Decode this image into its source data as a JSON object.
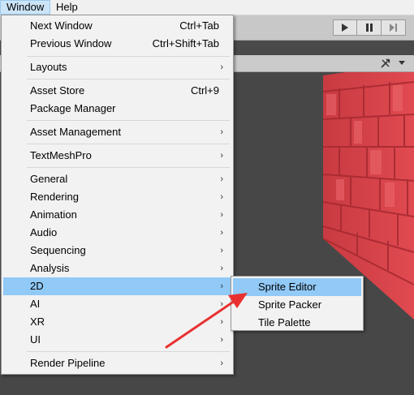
{
  "menubar": {
    "items": [
      "Window",
      "Help"
    ]
  },
  "window_menu": {
    "groups": [
      [
        {
          "label": "Next Window",
          "shortcut": "Ctrl+Tab"
        },
        {
          "label": "Previous Window",
          "shortcut": "Ctrl+Shift+Tab"
        }
      ],
      [
        {
          "label": "Layouts",
          "submenu": true
        }
      ],
      [
        {
          "label": "Asset Store",
          "shortcut": "Ctrl+9"
        },
        {
          "label": "Package Manager"
        }
      ],
      [
        {
          "label": "Asset Management",
          "submenu": true
        }
      ],
      [
        {
          "label": "TextMeshPro",
          "submenu": true
        }
      ],
      [
        {
          "label": "General",
          "submenu": true
        },
        {
          "label": "Rendering",
          "submenu": true
        },
        {
          "label": "Animation",
          "submenu": true
        },
        {
          "label": "Audio",
          "submenu": true
        },
        {
          "label": "Sequencing",
          "submenu": true
        },
        {
          "label": "Analysis",
          "submenu": true
        },
        {
          "label": "2D",
          "submenu": true,
          "highlighted": true
        },
        {
          "label": "AI",
          "submenu": true
        },
        {
          "label": "XR",
          "submenu": true
        },
        {
          "label": "UI",
          "submenu": true
        }
      ],
      [
        {
          "label": "Render Pipeline",
          "submenu": true
        }
      ]
    ],
    "submenu_arrow": "›"
  },
  "submenu_2d": {
    "items": [
      {
        "label": "Sprite Editor",
        "highlighted": true
      },
      {
        "label": "Sprite Packer"
      },
      {
        "label": "Tile Palette"
      }
    ]
  },
  "toolbar": {
    "play_icon": "play-icon",
    "pause_icon": "pause-icon",
    "step_icon": "step-icon"
  },
  "scene_tools": {
    "icons": [
      "tools-icon",
      "chevron-down-icon"
    ]
  },
  "colors": {
    "highlight": "#91c9f7",
    "menu_bg": "#f2f2f2",
    "arrow": "#e8312f",
    "wall": "#d8434a"
  }
}
